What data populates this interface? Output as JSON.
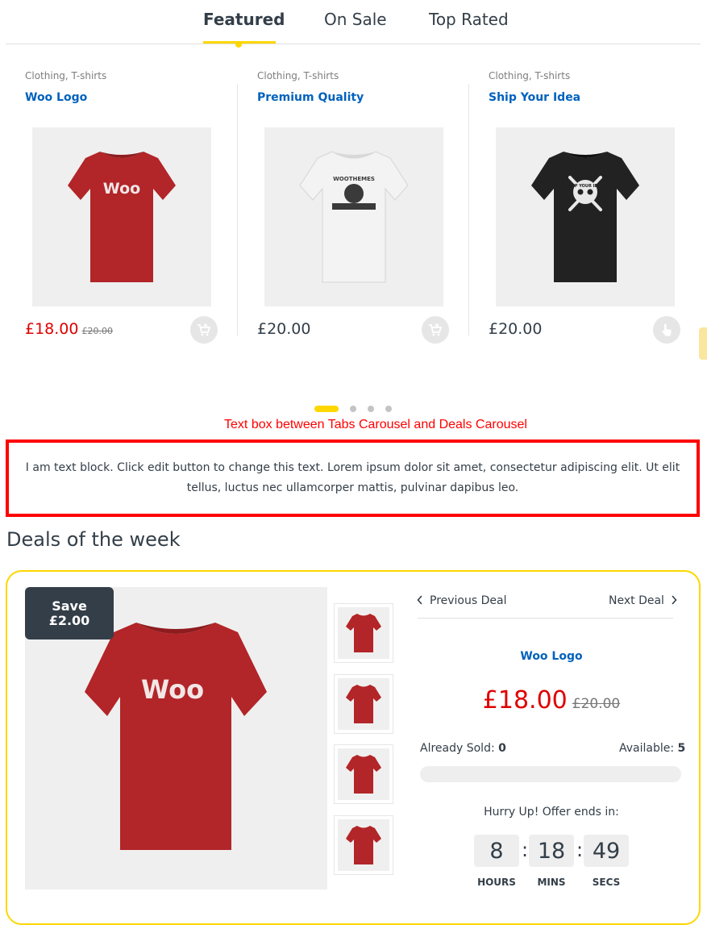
{
  "tabs": [
    {
      "label": "Featured",
      "active": true
    },
    {
      "label": "On Sale",
      "active": false
    },
    {
      "label": "Top Rated",
      "active": false
    }
  ],
  "products": [
    {
      "category": "Clothing, T-shirts",
      "title": "Woo Logo",
      "price": "£18.00",
      "old_price": "£20.00",
      "shirt_color": "#b22528",
      "print_text": "Woo",
      "action_icon": "add-to-cart-icon"
    },
    {
      "category": "Clothing, T-shirts",
      "title": "Premium Quality",
      "price": "£20.00",
      "old_price": "",
      "shirt_color": "#ebebeb",
      "print_text": "WOOTHEMES",
      "action_icon": "add-to-cart-icon"
    },
    {
      "category": "Clothing, T-shirts",
      "title": "Ship Your Idea",
      "price": "£20.00",
      "old_price": "",
      "shirt_color": "#222222",
      "print_text": "SHIP YOUR IDEA",
      "action_icon": "pointer-hand-icon"
    }
  ],
  "carousel": {
    "page_count": 4,
    "active_page": 1
  },
  "section_heading": "Text box between Tabs Carousel and Deals Carousel",
  "text_block": "I am text block. Click edit button to change this text. Lorem ipsum dolor sit amet, consectetur adipiscing elit. Ut elit tellus, luctus nec ullamcorper mattis, pulvinar dapibus leo.",
  "deals": {
    "heading": "Deals of the week",
    "save_label": "Save",
    "save_amount": "£2.00",
    "prev_label": "Previous Deal",
    "next_label": "Next Deal",
    "product_title": "Woo Logo",
    "price": "£18.00",
    "old_price": "£20.00",
    "sold_label": "Already Sold:",
    "sold_value": "0",
    "available_label": "Available:",
    "available_value": "5",
    "sold_fraction": 0,
    "hurry_text": "Hurry Up! Offer ends in:",
    "countdown": [
      {
        "value": "8",
        "label": "HOURS"
      },
      {
        "value": "18",
        "label": "MINS"
      },
      {
        "value": "49",
        "label": "SECS"
      }
    ],
    "separator": ":",
    "thumb_count": 4,
    "image_print": "Woo"
  },
  "colors": {
    "accent": "#fed700",
    "link": "#0062bd",
    "sale_price": "#df0000",
    "text": "#333e48",
    "highlight_border": "#ff0000"
  }
}
